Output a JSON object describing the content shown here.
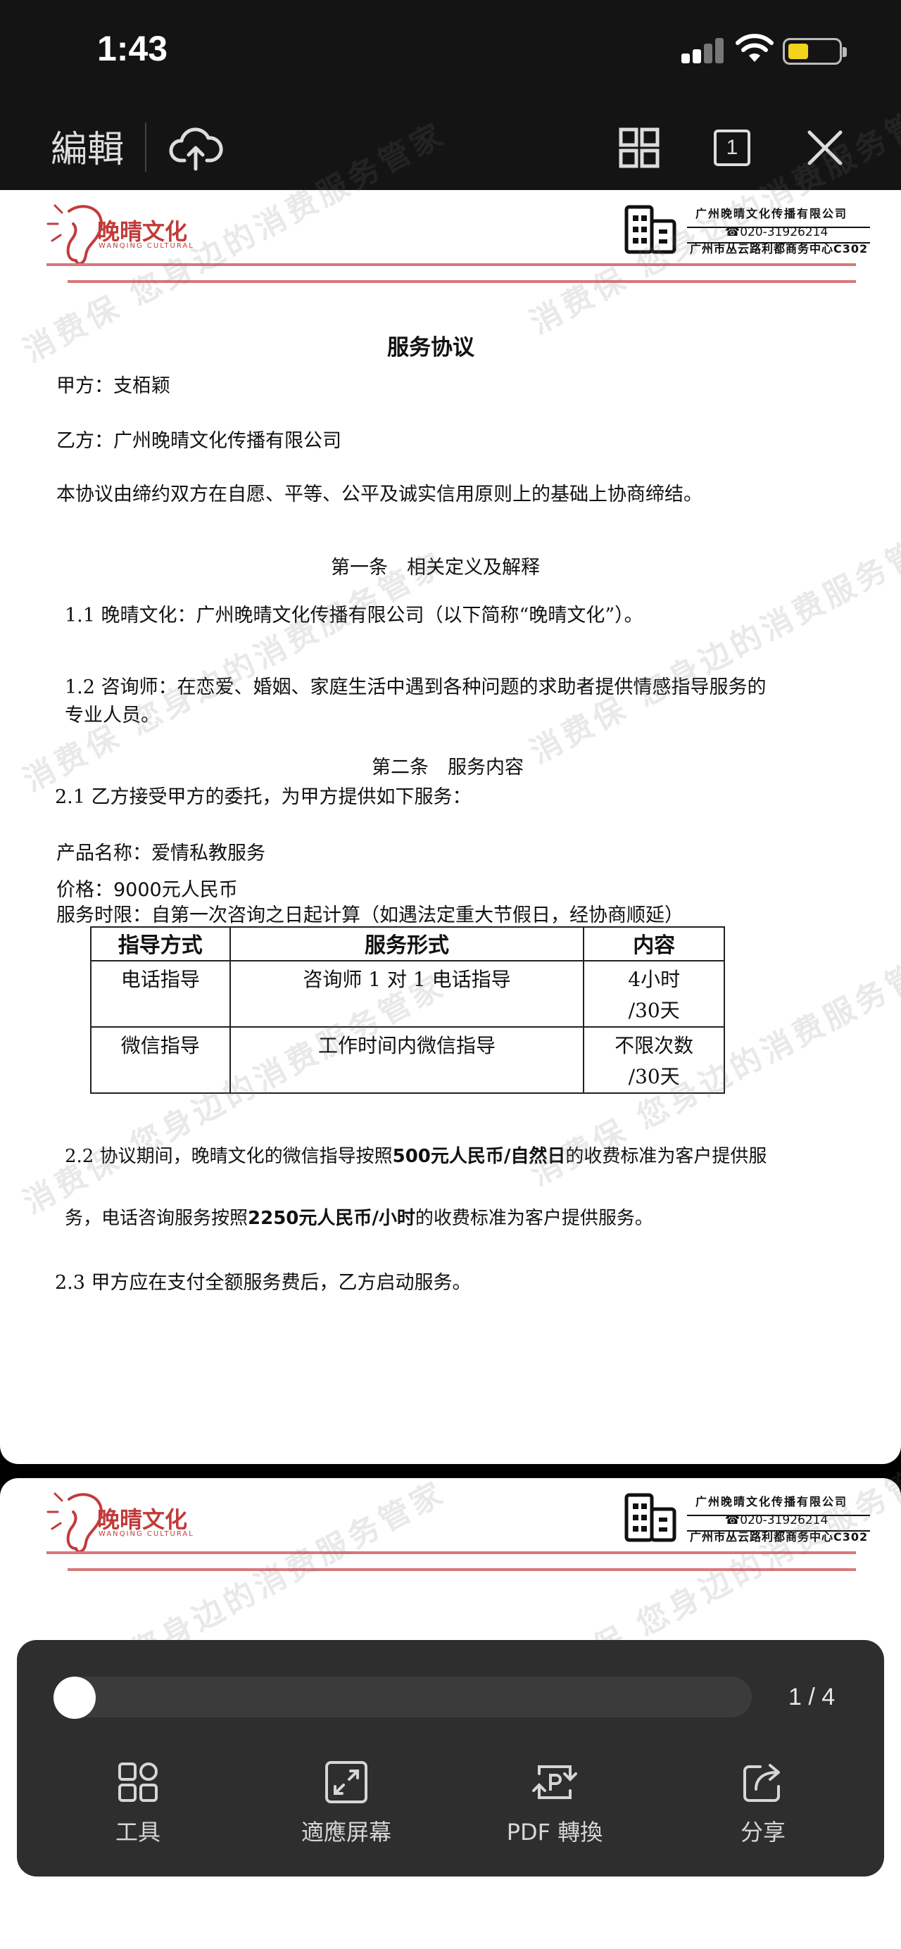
{
  "status": {
    "time": "1:43"
  },
  "toolbar": {
    "edit_label": "編輯",
    "page_button": "1"
  },
  "letterhead": {
    "brand_cn": "晚晴文化",
    "brand_en": "WANQING CULTURAL",
    "company": "广州晚晴文化传播有限公司",
    "phone": "020-31926214",
    "address": "广州市丛云路利都商务中心C302"
  },
  "document": {
    "title": "服务协议",
    "party_a": "甲方：支栢颖",
    "party_b": "乙方：广州晚晴文化传播有限公司",
    "intro": "本协议由缔约双方在自愿、平等、公平及诚实信用原则上的基础上协商缔结。",
    "article1_heading": "第一条　相关定义及解释",
    "clause_1_1": "1.1 晚晴文化：广州晚晴文化传播有限公司（以下简称“晚晴文化”）。",
    "clause_1_2_line1": "1.2 咨询师：在恋爱、婚姻、家庭生活中遇到各种问题的求助者提供情感指导服务的",
    "clause_1_2_line2": "专业人员。",
    "article2_heading": "第二条　服务内容",
    "clause_2_1": "2.1 乙方接受甲方的委托，为甲方提供如下服务：",
    "product": "产品名称：爱情私教服务",
    "price_label": "价格：",
    "price_value": "9000元人民币",
    "term": "服务时限：自第一次咨询之日起计算（如遇法定重大节假日，经协商顺延）",
    "table": {
      "headers": [
        "指导方式",
        "服务形式",
        "内容"
      ],
      "rows": [
        {
          "method": "电话指导",
          "form": "咨询师 1 对 1  电话指导",
          "content_line1": "4小时",
          "content_line2": "/30天"
        },
        {
          "method": "微信指导",
          "form": "工作时间内微信指导",
          "content_line1": "不限次数",
          "content_line2": "/30天"
        }
      ]
    },
    "clause_2_2_a": "2.2 协议期间，晚晴文化的微信指导按照",
    "clause_2_2_b": "500元人民币/自然日",
    "clause_2_2_c": "的收费标准为客户提供服",
    "clause_2_2_d": "务，电话咨询服务按照",
    "clause_2_2_e": "2250元人民币/小时",
    "clause_2_2_f": "的收费标准为客户提供服务。",
    "clause_2_3": "2.3 甲方应在支付全额服务费后，乙方启动服务。"
  },
  "watermark": "消费保 您身边的消费服务管家",
  "viewer": {
    "page_indicator": "1 / 4",
    "progress": 0.0,
    "actions": [
      "工具",
      "適應屏幕",
      "PDF 轉換",
      "分享"
    ]
  }
}
